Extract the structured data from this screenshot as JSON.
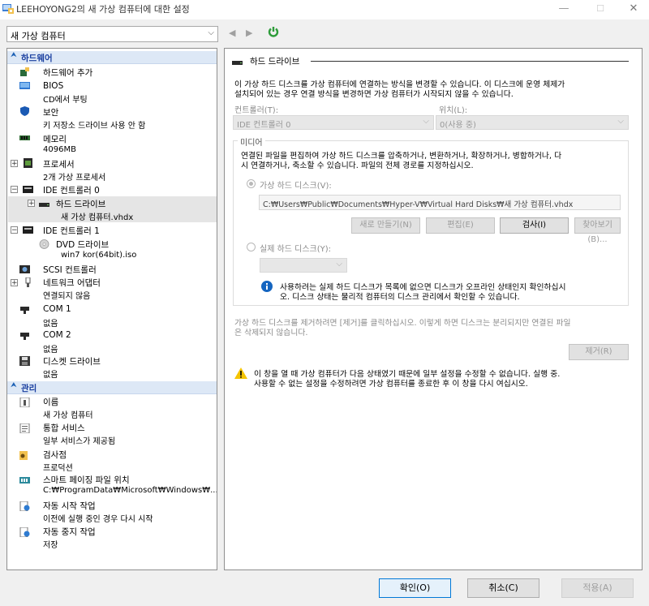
{
  "window": {
    "title": "LEEHOYONG2의 새 가상 컴퓨터에 대한 설정",
    "minimize_glyph": "—",
    "maximize_glyph": "☐",
    "close_glyph": "✕"
  },
  "toolbar": {
    "vm_selected": "새 가상 컴퓨터",
    "dropdown_glyph": "⌵",
    "back_glyph": "◀",
    "forward_glyph": "▶",
    "accent_color": "#2e9c3a"
  },
  "tree": {
    "hardware_section": "하드웨어",
    "management_section": "관리",
    "collapse_glyph": "⮝",
    "expand_plus": "+",
    "expand_minus": "−",
    "hardware": [
      {
        "name": "하드웨어 추가",
        "sub": ""
      },
      {
        "name": "BIOS",
        "sub": "CD에서 부팅"
      },
      {
        "name": "보안",
        "sub": "키 저장소 드라이브 사용 안 함"
      },
      {
        "name": "메모리",
        "sub": "4096MB"
      },
      {
        "name": "프로세서",
        "sub": "2개 가상 프로세서"
      },
      {
        "name": "IDE 컨트롤러 0",
        "sub": ""
      },
      {
        "name": "하드 드라이브",
        "sub": "새 가상 컴퓨터.vhdx"
      },
      {
        "name": "IDE 컨트롤러 1",
        "sub": ""
      },
      {
        "name": "DVD 드라이브",
        "sub": "win7 kor(64bit).iso"
      },
      {
        "name": "SCSI 컨트롤러",
        "sub": ""
      },
      {
        "name": "네트워크 어댑터",
        "sub": "연결되지 않음"
      },
      {
        "name": "COM 1",
        "sub": "없음"
      },
      {
        "name": "COM 2",
        "sub": "없음"
      },
      {
        "name": "디스켓 드라이브",
        "sub": "없음"
      }
    ],
    "management": [
      {
        "name": "이름",
        "sub": "새 가상 컴퓨터"
      },
      {
        "name": "통합 서비스",
        "sub": "일부 서비스가 제공됨"
      },
      {
        "name": "검사점",
        "sub": "프로덕션"
      },
      {
        "name": "스마트 페이징 파일 위치",
        "sub": "C:₩ProgramData₩Microsoft₩Windows₩..."
      },
      {
        "name": "자동 시작 작업",
        "sub": "이전에 실행 중인 경우 다시 시작"
      },
      {
        "name": "자동 중지 작업",
        "sub": "저장"
      }
    ]
  },
  "panel": {
    "heading": "하드 드라이브",
    "intro_line1": "이 가상 하드 디스크를 가상 컴퓨터에 연결하는 방식을 변경할 수 있습니다. 이 디스크에 운영 체제가",
    "intro_line2": "설치되어 있는 경우 연결 방식을 변경하면 가상 컴퓨터가 시작되지 않을 수 있습니다.",
    "controller_label": "컨트롤러(T):",
    "controller_value": "IDE 컨트롤러 0",
    "location_label": "위치(L):",
    "location_value": "0(사용 중)",
    "media_label": "미디어",
    "media_desc1": "연결된 파일을 편집하여 가상 하드 디스크를 압축하거나, 변환하거나, 확장하거나, 병합하거나, 다",
    "media_desc2": "시 연결하거나, 축소할 수 있습니다. 파일의 전체 경로를 지정하십시오.",
    "vhd_label": "가상 하드 디스크(V):",
    "vhd_path": "C:₩Users₩Public₩Documents₩Hyper-V₩Virtual Hard Disks₩새 가상 컴퓨터.vhdx",
    "new_btn": "새로 만들기(N)",
    "edit_btn": "편집(E)",
    "inspect_btn": "검사(I)",
    "browse_btn": "찾아보기(B)...",
    "physical_label": "실제 하드 디스크(Y):",
    "info_line1": "사용하려는 실제 하드 디스크가 목록에 없으면 디스크가 오프라인 상태인지 확인하십시",
    "info_line2": "오. 디스크 상태는 물리적 컴퓨터의 디스크 관리에서 확인할 수 있습니다.",
    "remove_desc1": "가상 하드 디스크를 제거하려면 [제거]를 클릭하십시오. 이렇게 하면 디스크는 분리되지만 연결된 파일",
    "remove_desc2": "은 삭제되지 않습니다.",
    "remove_btn": "제거(R)",
    "warn_line1": "이 창을 열 때 가상 컴퓨터가 다음 상태였기 때문에 일부 설정을 수정할 수 없습니다. 실행 중.",
    "warn_line2": "사용할 수 없는 설정을 수정하려면 가상 컴퓨터를 종료한 후 이 창을 다시 여십시오."
  },
  "footer": {
    "ok": "확인(O)",
    "cancel": "취소(C)",
    "apply": "적용(A)"
  }
}
